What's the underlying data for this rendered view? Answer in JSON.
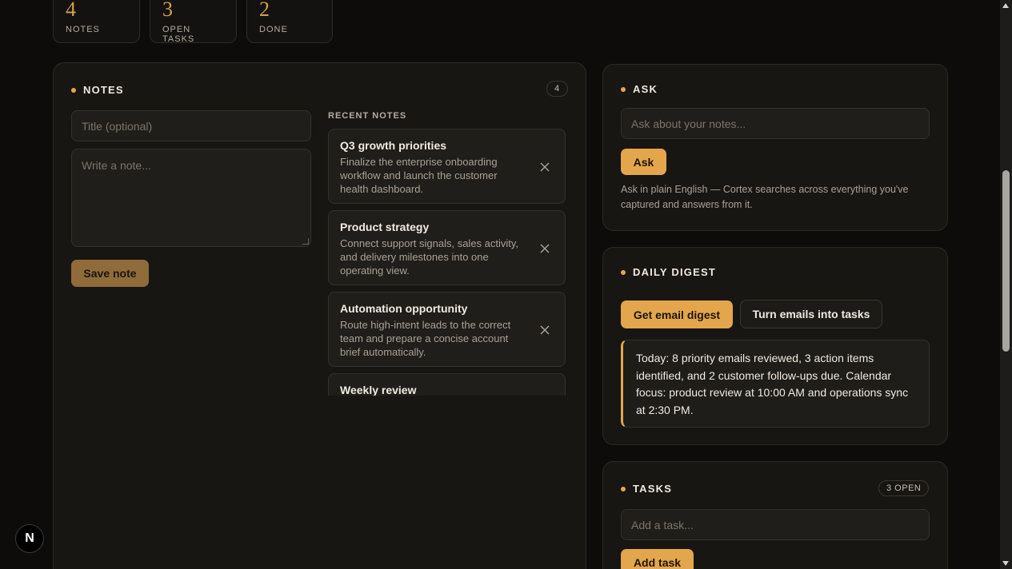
{
  "stats": [
    {
      "value": "4",
      "label": "NOTES"
    },
    {
      "value": "3",
      "label": "OPEN TASKS"
    },
    {
      "value": "2",
      "label": "DONE"
    }
  ],
  "notes_panel": {
    "title": "NOTES",
    "count": "4",
    "title_placeholder": "Title (optional)",
    "body_placeholder": "Write a note...",
    "save_label": "Save note",
    "recent_label": "RECENT NOTES",
    "items": [
      {
        "title": "Q3 growth priorities",
        "body": "Finalize the enterprise onboarding workflow and launch the customer health dashboard."
      },
      {
        "title": "Product strategy",
        "body": "Connect support signals, sales activity, and delivery milestones into one operating view."
      },
      {
        "title": "Automation opportunity",
        "body": "Route high-intent leads to the correct team and prepare a concise account brief automatically."
      },
      {
        "title": "Weekly review",
        "body": ""
      }
    ]
  },
  "ask_panel": {
    "title": "ASK",
    "placeholder": "Ask about your notes...",
    "button_label": "Ask",
    "helper": "Ask in plain English — Cortex searches across everything you've captured and answers from it."
  },
  "digest_panel": {
    "title": "DAILY DIGEST",
    "primary_label": "Get email digest",
    "secondary_label": "Turn emails into tasks",
    "summary": "Today: 8 priority emails reviewed, 3 action items identified, and 2 customer follow-ups due. Calendar focus: product review at 10:00 AM and operations sync at 2:30 PM."
  },
  "tasks_panel": {
    "title": "TASKS",
    "badge": "3 OPEN",
    "placeholder": "Add a task...",
    "button_label": "Add task"
  },
  "framework_badge": "N",
  "colors": {
    "accent": "#e3a64c",
    "background": "#0d0c0b",
    "card": "#181613"
  }
}
